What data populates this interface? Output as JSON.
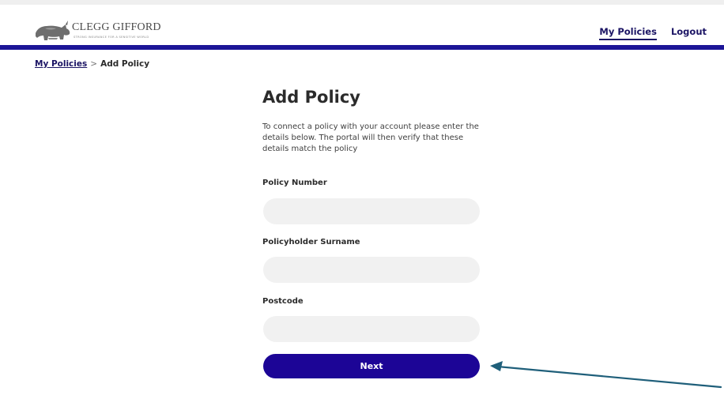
{
  "header": {
    "brand_name": "CLEGG GIFFORD",
    "brand_tagline": "STRONG INSURANCE FOR A SENSITIVE WORLD",
    "logo_icon": "rhino-icon",
    "nav": {
      "my_policies": "My Policies",
      "logout": "Logout"
    }
  },
  "breadcrumb": {
    "parent": "My Policies",
    "separator": ">",
    "current": "Add Policy"
  },
  "form": {
    "title": "Add Policy",
    "intro": "To connect a policy with your account please enter the details below. The portal will then verify that these details match the policy",
    "fields": [
      {
        "label": "Policy Number",
        "value": "",
        "placeholder": ""
      },
      {
        "label": "Policyholder Surname",
        "value": "",
        "placeholder": ""
      },
      {
        "label": "Postcode",
        "value": "",
        "placeholder": ""
      }
    ],
    "submit_label": "Next"
  },
  "annotation": {
    "arrow_icon": "arrow-pointer-icon",
    "arrow_color": "#1f5f7a"
  },
  "colors": {
    "brand": "#1c1597",
    "button": "#1c0596",
    "input_bg": "#f1f1f1"
  }
}
